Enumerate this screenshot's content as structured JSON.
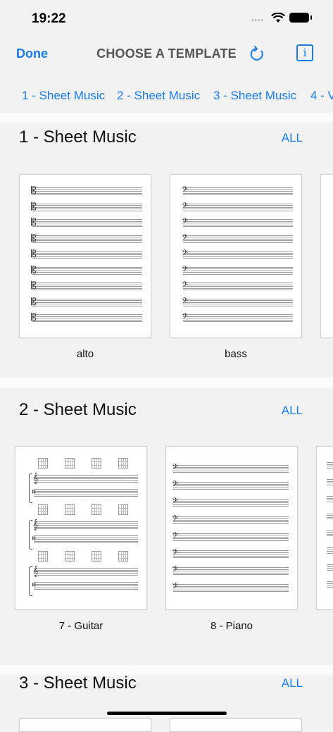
{
  "status": {
    "time": "19:22"
  },
  "nav": {
    "done_label": "Done",
    "title": "CHOOSE A TEMPLATE",
    "refresh_icon": "refresh-icon",
    "info_icon": "info-icon"
  },
  "tabs": [
    "1 - Sheet Music",
    "2 - Sheet Music",
    "3 - Sheet Music",
    "4 - V"
  ],
  "sections": [
    {
      "title": "1 - Sheet Music",
      "all_label": "ALL",
      "cards": [
        {
          "label": "alto"
        },
        {
          "label": "bass"
        }
      ]
    },
    {
      "title": "2 - Sheet Music",
      "all_label": "ALL",
      "cards": [
        {
          "label": "7 - Guitar"
        },
        {
          "label": "8 - Piano"
        }
      ]
    },
    {
      "title": "3 - Sheet Music",
      "all_label": "ALL"
    }
  ],
  "colors": {
    "accent": "#1a7ce6",
    "background": "#f2f2f2"
  }
}
